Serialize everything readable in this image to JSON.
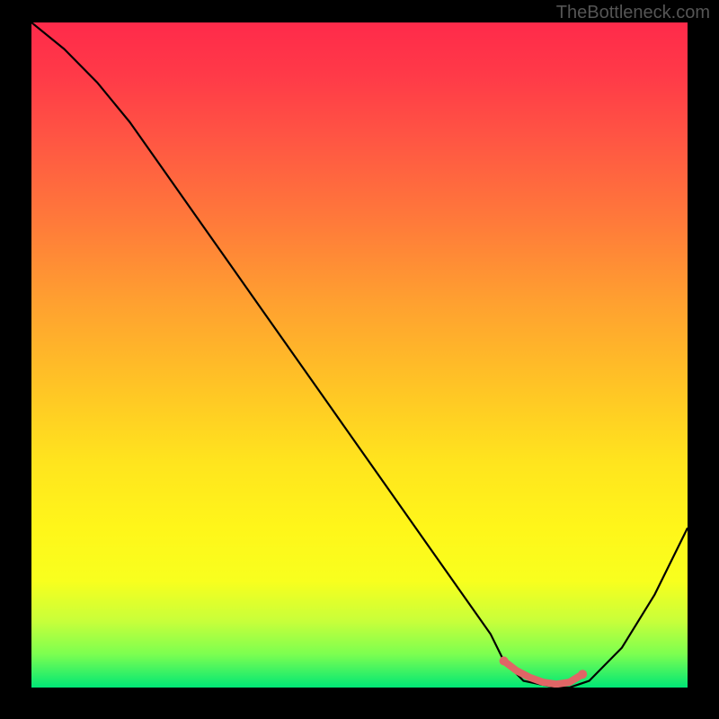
{
  "watermark": "TheBottleneck.com",
  "chart_data": {
    "type": "line",
    "title": "",
    "xlabel": "",
    "ylabel": "",
    "xlim": [
      0,
      100
    ],
    "ylim": [
      0,
      100
    ],
    "series": [
      {
        "name": "bottleneck-curve",
        "x": [
          0,
          5,
          10,
          15,
          20,
          25,
          30,
          35,
          40,
          45,
          50,
          55,
          60,
          65,
          70,
          72,
          75,
          80,
          82,
          85,
          90,
          95,
          100
        ],
        "values": [
          100,
          96,
          91,
          85,
          78,
          71,
          64,
          57,
          50,
          43,
          36,
          29,
          22,
          15,
          8,
          4,
          1,
          0,
          0,
          1,
          6,
          14,
          24
        ]
      }
    ],
    "highlight": {
      "name": "optimal-range",
      "x": [
        72,
        74,
        76,
        78,
        80,
        82,
        84
      ],
      "values": [
        4,
        2.5,
        1.5,
        0.8,
        0.5,
        0.8,
        2
      ]
    },
    "colors": {
      "curve": "#000000",
      "highlight": "#e06666",
      "gradient_top": "#ff2a4a",
      "gradient_bottom": "#00e676"
    }
  }
}
